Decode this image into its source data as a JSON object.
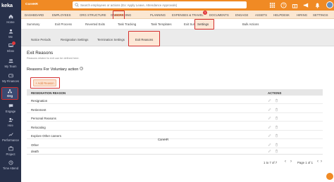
{
  "app": {
    "logo": "keka",
    "company": "CoreHR"
  },
  "search": {
    "placeholder": "Search employees or actions (Ex: Apply Leave, Attendance Approvals)"
  },
  "sidebar": {
    "items": [
      {
        "label": "Home",
        "icon": "home-icon"
      },
      {
        "label": "Me",
        "icon": "user-icon"
      },
      {
        "label": "Inbox",
        "icon": "inbox-icon"
      },
      {
        "label": "My Team",
        "icon": "team-icon"
      },
      {
        "label": "My Finances",
        "icon": "wallet-icon"
      },
      {
        "label": "Org",
        "icon": "org-icon"
      },
      {
        "label": "Engage",
        "icon": "engage-icon"
      },
      {
        "label": "Hire",
        "icon": "hire-icon"
      },
      {
        "label": "Performance",
        "icon": "performance-icon"
      },
      {
        "label": "Project",
        "icon": "project-icon"
      },
      {
        "label": "Time Attend",
        "icon": "clock-icon"
      }
    ]
  },
  "main_nav": {
    "items": [
      "DASHBOARD",
      "EMPLOYEES",
      "ORG STRUCTURE",
      "ONBOARDING",
      "EXITS",
      "PLANNING",
      "EXPENSES & TRAVEL",
      "DOCUMENTS",
      "ENGAGE",
      "ASSETS",
      "HELPDESK",
      "HIRING",
      "SETTINGS"
    ],
    "active": "EXITS",
    "badge": "1"
  },
  "sub_nav": {
    "items": [
      "Summary",
      "Exit Process",
      "Reverted Exits",
      "Task Tracking",
      "Task Templates",
      "Exit Survey",
      "Settings",
      "Bulk Actions"
    ],
    "active": "Settings"
  },
  "settings_tabs": {
    "items": [
      "Notice Periods",
      "Resignation Settings",
      "Termination Settings",
      "Exit Reasons"
    ],
    "active": "Exit Reasons"
  },
  "page": {
    "title": "Exit Reasons",
    "subtitle": "Reasons related to exit can be defined here.",
    "section_title": "Reasons For Voluntary action",
    "help_glyph": "?",
    "add_button": "+ Add Reason"
  },
  "table": {
    "columns": [
      "RESIGNATION REASON",
      "ACTIONS"
    ],
    "rows": [
      "Resignation",
      "Retirement",
      "Personal Reasons",
      "Relocating",
      "Explore Other careers",
      "Other",
      "death"
    ]
  },
  "tooltip": "CoreHR",
  "pagination": {
    "range": "1 to 7 of 7",
    "page": "Page 1 of 1"
  },
  "colors": {
    "accent": "#f08a24",
    "sidebar": "#27304a",
    "highlight": "#d32f2f"
  }
}
